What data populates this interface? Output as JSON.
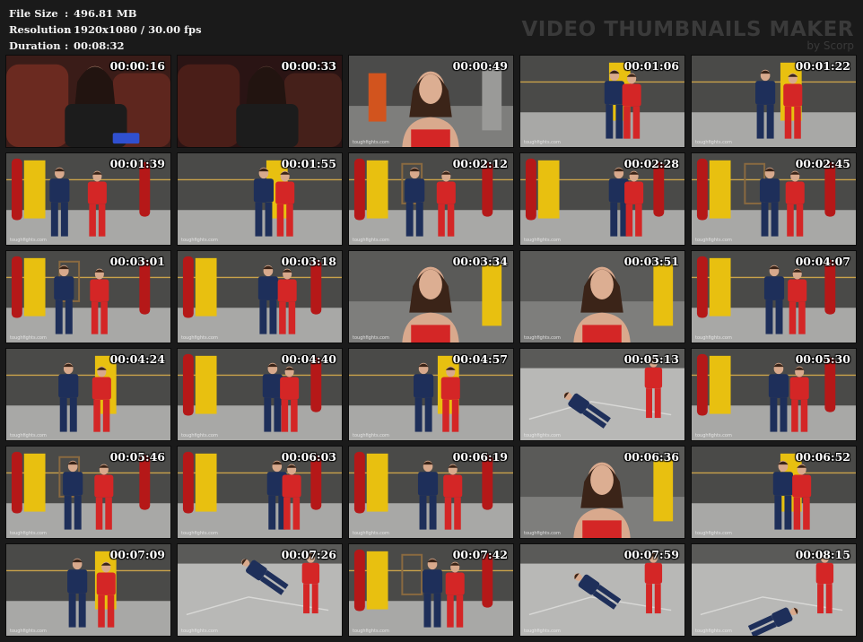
{
  "info": {
    "file_size": {
      "label": "File Size",
      "value": "496.81 MB"
    },
    "resolution": {
      "label": "Resolution",
      "value": "1920x1080 / 30.00 fps"
    },
    "duration": {
      "label": "Duration",
      "value": "00:08:32"
    },
    "separator": ":"
  },
  "brand": {
    "title": "VIDEO THUMBNAILS MAKER",
    "subtitle": "by Scorp"
  },
  "watermark": "toughfights.com",
  "thumbnails": [
    {
      "time": "00:00:16",
      "scene": "couch"
    },
    {
      "time": "00:00:33",
      "scene": "couch-dark"
    },
    {
      "time": "00:00:49",
      "scene": "portrait"
    },
    {
      "time": "00:01:06",
      "scene": "gym-yellow"
    },
    {
      "time": "00:01:22",
      "scene": "gym-yellow"
    },
    {
      "time": "00:01:39",
      "scene": "gym-red"
    },
    {
      "time": "00:01:55",
      "scene": "gym-yellow"
    },
    {
      "time": "00:02:12",
      "scene": "gym-wide"
    },
    {
      "time": "00:02:28",
      "scene": "gym-red"
    },
    {
      "time": "00:02:45",
      "scene": "gym-wide"
    },
    {
      "time": "00:03:01",
      "scene": "gym-wide"
    },
    {
      "time": "00:03:18",
      "scene": "gym-red"
    },
    {
      "time": "00:03:34",
      "scene": "portrait-gym"
    },
    {
      "time": "00:03:51",
      "scene": "portrait-gym"
    },
    {
      "time": "00:04:07",
      "scene": "gym-red"
    },
    {
      "time": "00:04:24",
      "scene": "gym-yellow"
    },
    {
      "time": "00:04:40",
      "scene": "gym-red"
    },
    {
      "time": "00:04:57",
      "scene": "gym-yellow"
    },
    {
      "time": "00:05:13",
      "scene": "mat"
    },
    {
      "time": "00:05:30",
      "scene": "gym-red"
    },
    {
      "time": "00:05:46",
      "scene": "gym-wide"
    },
    {
      "time": "00:06:03",
      "scene": "gym-red"
    },
    {
      "time": "00:06:19",
      "scene": "gym-red"
    },
    {
      "time": "00:06:36",
      "scene": "portrait-gym"
    },
    {
      "time": "00:06:52",
      "scene": "gym-yellow"
    },
    {
      "time": "00:07:09",
      "scene": "gym-yellow"
    },
    {
      "time": "00:07:26",
      "scene": "mat"
    },
    {
      "time": "00:07:42",
      "scene": "gym-wide"
    },
    {
      "time": "00:07:59",
      "scene": "mat"
    },
    {
      "time": "00:08:15",
      "scene": "mat"
    }
  ]
}
